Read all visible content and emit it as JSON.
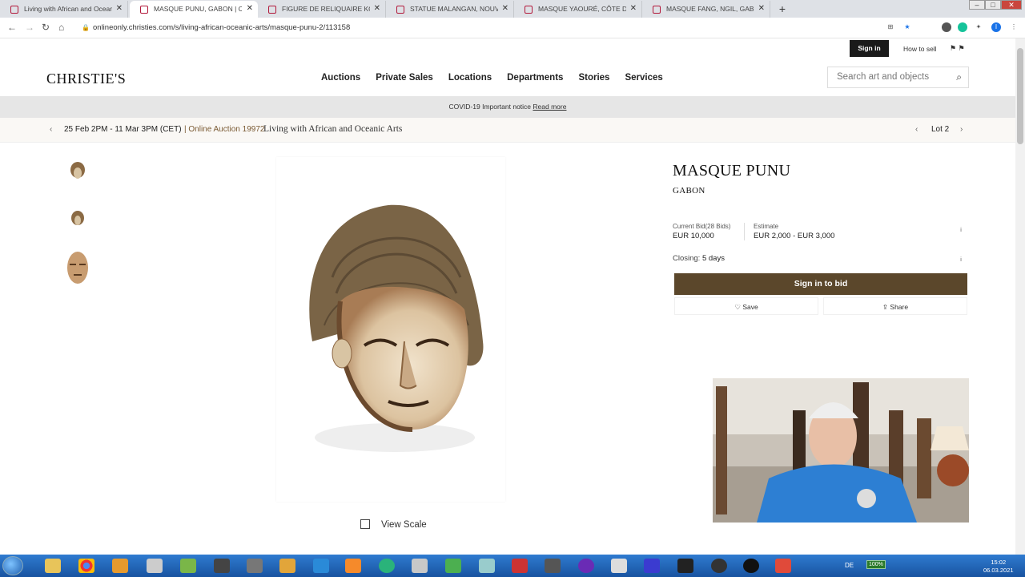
{
  "browser": {
    "tabs": [
      {
        "title": "Living with African and Oceanic A"
      },
      {
        "title": "MASQUE PUNU, GABON | Christi"
      },
      {
        "title": "FIGURE DE RELIQUAIRE KOTA-OB"
      },
      {
        "title": "STATUE MALANGAN, NOUVELLE-"
      },
      {
        "title": "MASQUE YAOURÉ, CÔTE D'IVOIR"
      },
      {
        "title": "MASQUE FANG, NGIL, GABON | C"
      }
    ],
    "url": "onlineonly.christies.com/s/living-african-oceanic-arts/masque-punu-2/113158"
  },
  "site": {
    "sign_in": "Sign in",
    "how_to_sell": "How to sell",
    "logo": "CHRISTIE'S",
    "nav": [
      "Auctions",
      "Private Sales",
      "Locations",
      "Departments",
      "Stories",
      "Services"
    ],
    "search_placeholder": "Search art and objects",
    "notice_text": "COVID-19 Important notice",
    "notice_link": "Read more"
  },
  "lot_bar": {
    "dates": "25 Feb 2PM - 11 Mar 3PM (CET)",
    "auction_number": "| Online Auction 19972",
    "auction_name": "Living with African and Oceanic Arts",
    "lot": "Lot 2"
  },
  "lot": {
    "title": "MASQUE PUNU",
    "subtitle": "GABON",
    "current_bid_label": "Current Bid(28 Bids)",
    "current_bid_value": "EUR 10,000",
    "estimate_label": "Estimate",
    "estimate_value": "EUR 2,000 - EUR 3,000",
    "closing_label": "Closing:",
    "closing_value": "5 days",
    "bid_button": "Sign in to bid",
    "save": "Save",
    "share": "Share",
    "view_scale": "View Scale"
  },
  "taskbar": {
    "language": "DE",
    "battery": "100%",
    "time": "15:02",
    "date": "06.03.2021"
  },
  "colors": {
    "bid_button": "#5b472b",
    "accent_brown": "#7a5a33",
    "taskbar": "#1853a0"
  }
}
